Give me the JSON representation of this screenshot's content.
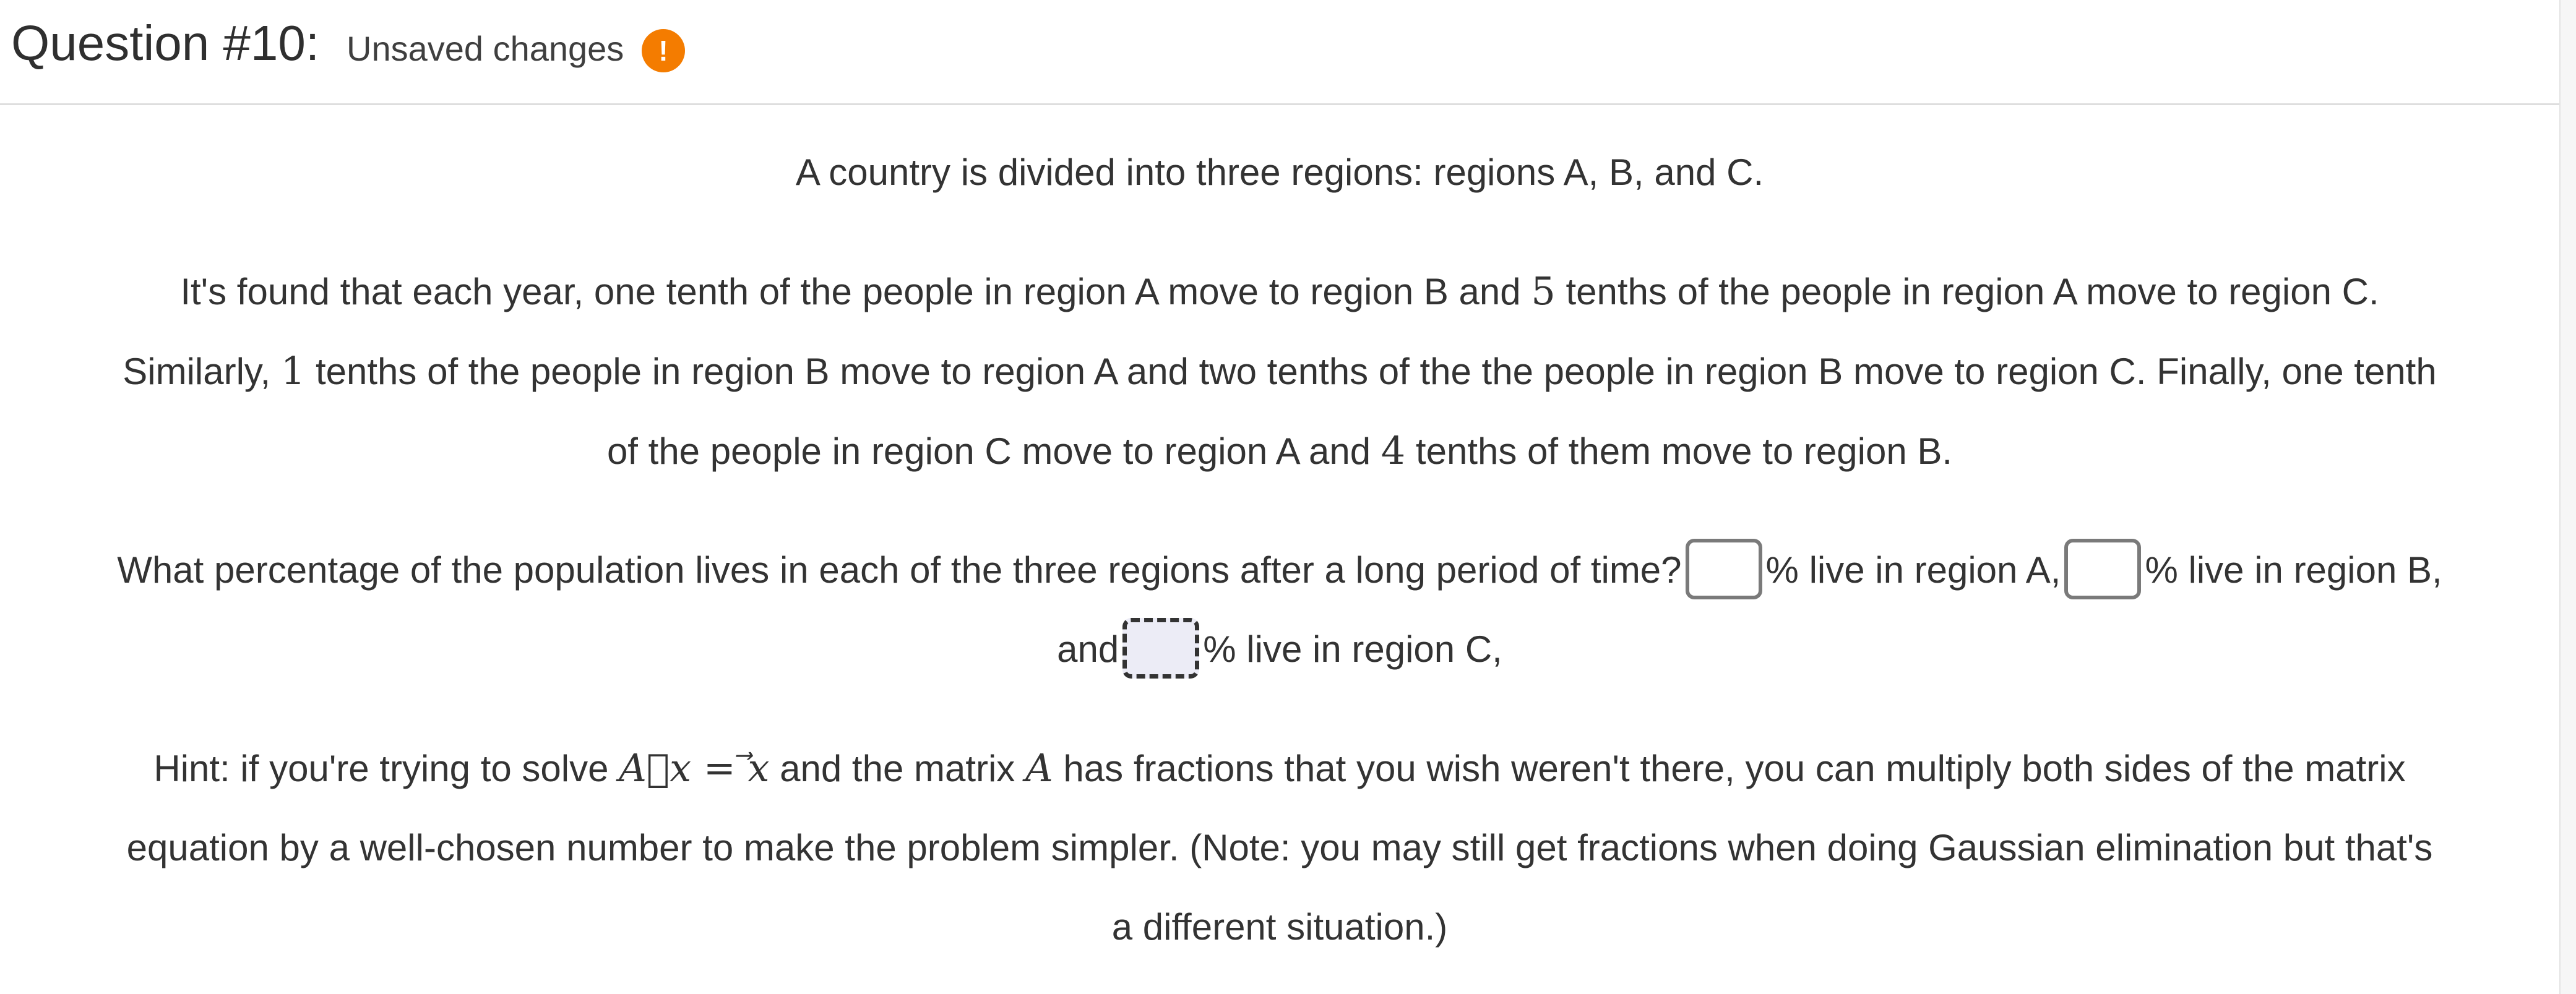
{
  "header": {
    "title": "Question #10:",
    "status": "Unsaved changes",
    "warning_icon": "!"
  },
  "problem": {
    "intro": "A country is divided into three regions: regions A, B, and C.",
    "moves": {
      "line1_a": "It's found that each year, one tenth of the people in region A move to region B and ",
      "n1": "5",
      "line1_b": " tenths of the people in region A move to region C.",
      "line2_a": "Similarly, ",
      "n2": "1",
      "line2_b": " tenths of the people in region B move to region A and two tenths of the the people in region B move to region C. Finally, one tenth",
      "line3_a": "of the people in region C move to region A and ",
      "n3": "4",
      "line3_b": " tenths of them move to region B."
    },
    "question": {
      "prompt": "What percentage of the population lives in each of the three regions after a long period of time?",
      "after_a": "% live in region A,",
      "after_b": "% live in region B,",
      "lead_c": "and",
      "after_c": "% live in region C,",
      "answers": {
        "region_a": "",
        "region_b": "",
        "region_c": ""
      }
    },
    "hint": {
      "a": "Hint: if you're trying to solve ",
      "eq_lhs": "A⃗x",
      "eq_op": " = ",
      "eq_rhs": "⃗x",
      "b": " and the matrix ",
      "matrix": "A",
      "c": " has fractions that you wish weren't there, you can multiply both sides of the matrix",
      "line2": "equation by a well-chosen number to make the problem simpler. (Note: you may still get fractions when doing Gaussian elimination but that's",
      "line3": "a different situation.)"
    }
  }
}
